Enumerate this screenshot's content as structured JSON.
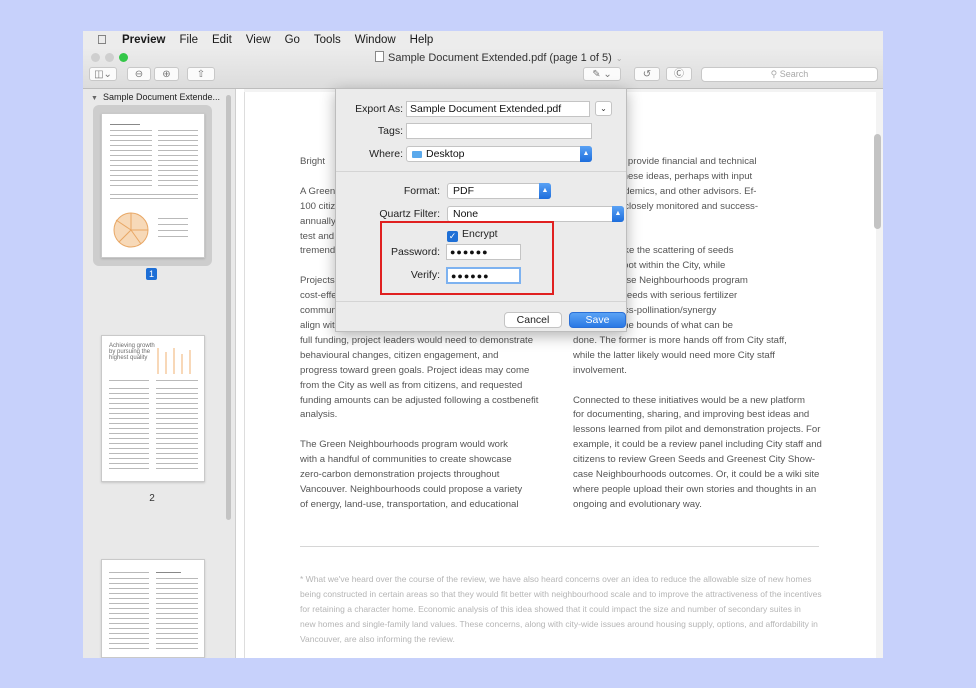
{
  "menubar": {
    "app": "Preview",
    "items": [
      "File",
      "Edit",
      "View",
      "Go",
      "Tools",
      "Window",
      "Help"
    ]
  },
  "window": {
    "title": "Sample Document Extended.pdf (page 1 of 5)"
  },
  "toolbar": {
    "search_placeholder": "Search"
  },
  "sidebar": {
    "doc_name": "Sample Document Extende...",
    "page_labels": [
      "1",
      "2"
    ],
    "thumb2_heading": "Achieving growth\nby pursuing the\nhighest quality"
  },
  "page": {
    "left_col": "Bright\n\nA Green\n100 citiz\nannually.\ntest and\ntremend\n\nProjects\ncost-effe\ncommun\nalign with\nfull funding, project leaders would need to demonstrate\nbehavioural changes, citizen engagement, and\nprogress toward green goals. Project ideas may come\nfrom the City as well as from citizens, and requested\nfunding amounts can be adjusted following a costbenefit\nanalysis.\n\nThe Green Neighbourhoods program would work\nwith a handful of communities to create showcase\nzero-carbon demonstration projects throughout\nVancouver. Neighbourhoods could propose a variety\nof energy, land-use, transportation, and educational",
    "right_col": "e City would provide financial and technical\nbuild upon these ideas, perhaps with input\nnesses, academics, and other advisors. Ef-\nts would be closely monitored and success-\nicated.\n\nds Fund is like the scattering of seeds\nmight take root within the City, while\nCity Showcase Neighbourhoods program\nng multiple seeds with serious fertilizer\nul study, cross-pollination/synergy\nnd to push the bounds of what can be\ndone. The former is more hands off from City staff,\nwhile the latter likely would need more City staff\ninvolvement.\n\nConnected to these initiatives would be a new platform\nfor documenting, sharing, and improving best ideas and\nlessons learned from pilot and demonstration projects. For\nexample, it could be a review panel including City staff and\ncitizens to review Green Seeds and Greenest City Show-\ncase Neighbourhoods outcomes. Or, it could be a wiki site\nwhere people upload their own stories and thoughts in an\nongoing and evolutionary way.",
    "footnote": "* What we've heard over the course of the review, we have also heard concerns over an idea to reduce the allowable size of new homes\nbeing constructed in certain areas so that they would fit better with neighbourhood scale and to improve the attractiveness of the incentives\nfor retaining a character home. Economic analysis of this idea showed that it could impact the size and number of secondary suites in\nnew homes and single-family land values. These concerns, along with city-wide issues around housing supply, options, and affordability in\nVancouver, are also informing the review."
  },
  "export_sheet": {
    "export_as_label": "Export As:",
    "export_as_value": "Sample Document Extended.pdf",
    "tags_label": "Tags:",
    "tags_value": "",
    "where_label": "Where:",
    "where_value": "Desktop",
    "format_label": "Format:",
    "format_value": "PDF",
    "quartz_label": "Quartz Filter:",
    "quartz_value": "None",
    "encrypt_label": "Encrypt",
    "encrypt_checked": true,
    "password_label": "Password:",
    "password_value": "●●●●●●",
    "verify_label": "Verify:",
    "verify_value": "●●●●●●",
    "cancel_label": "Cancel",
    "save_label": "Save"
  },
  "colors": {
    "accent": "#1e6fd6",
    "highlight": "#e02020",
    "background": "#c7d1fb"
  }
}
